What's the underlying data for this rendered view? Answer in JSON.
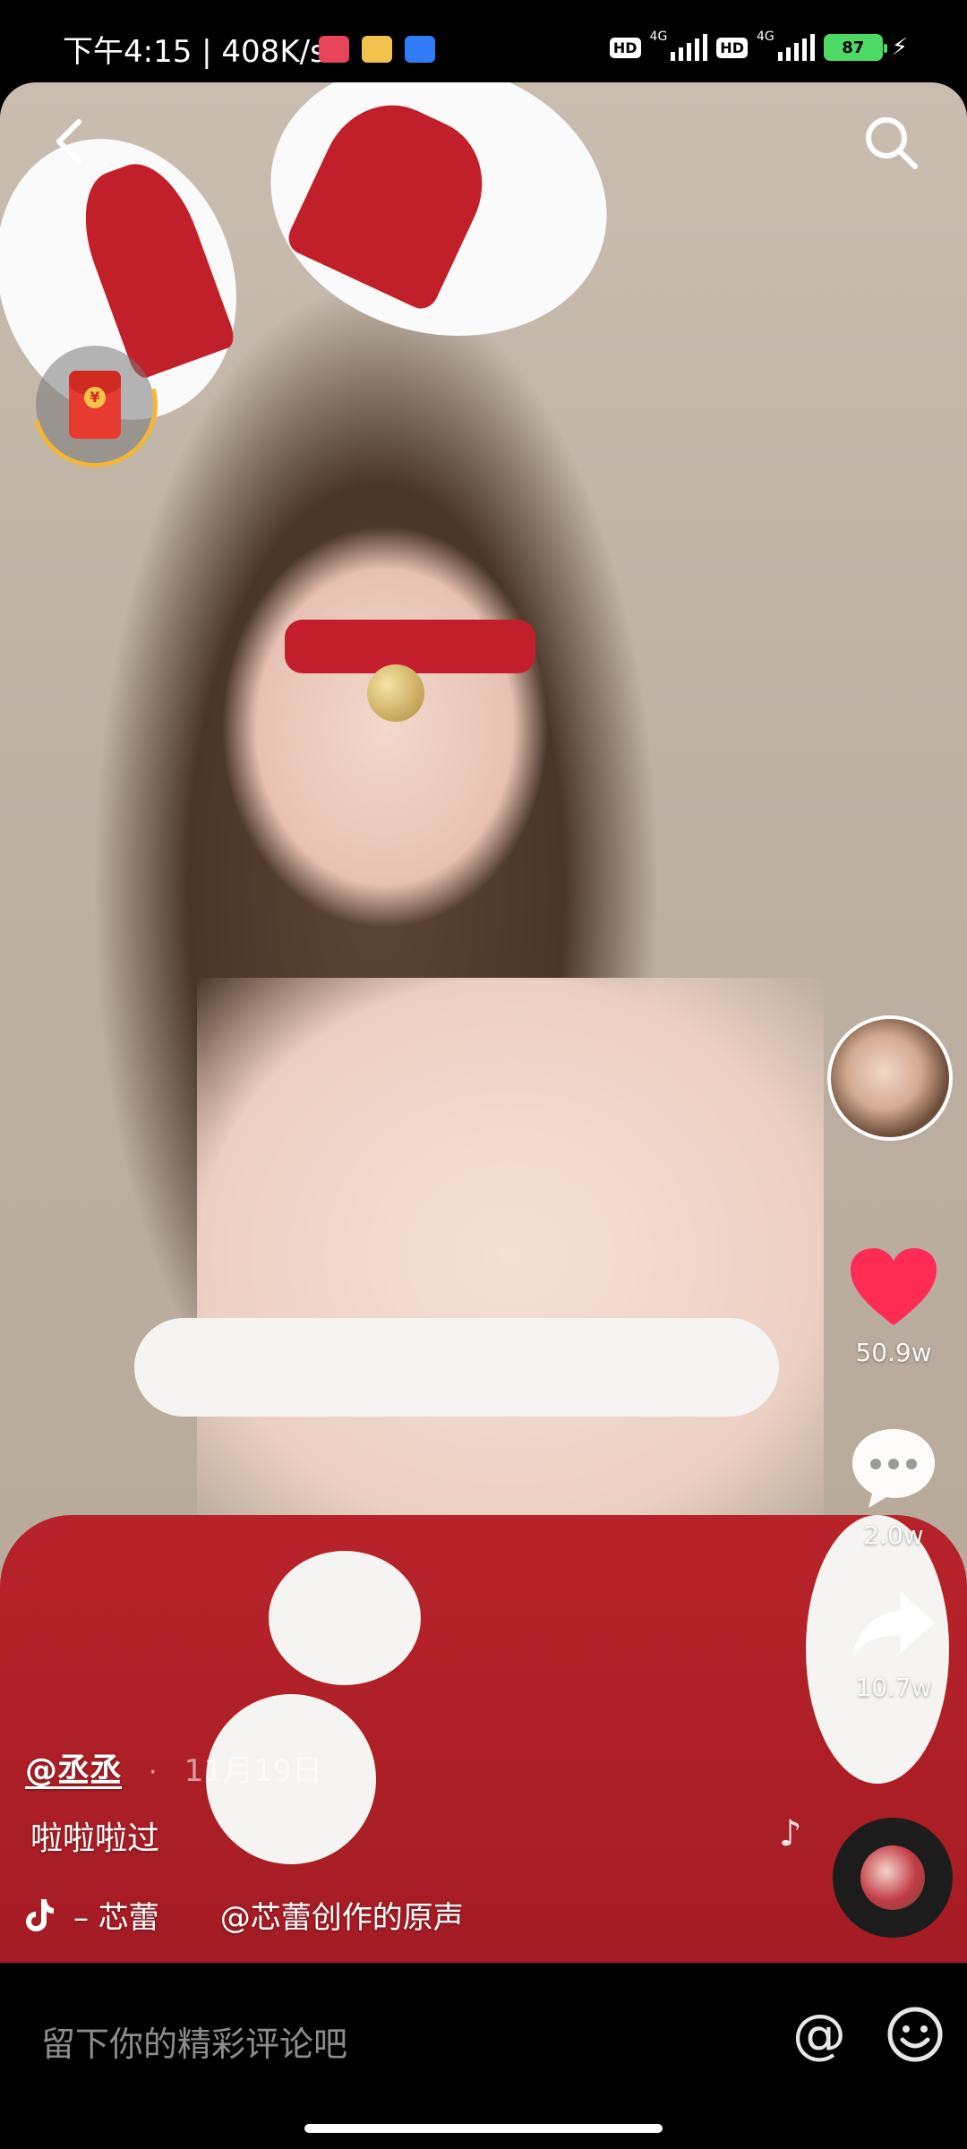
{
  "status_bar": {
    "time": "下午4:15 | 408K/s",
    "network_1": "4G",
    "network_2": "4G",
    "hd_label": "HD",
    "battery": "87"
  },
  "video": {
    "author": "@丞丞",
    "separator": "·",
    "date": "11月19日",
    "description": "啦啦啦过",
    "music": "– 芯蕾　　@芯蕾创作的原声"
  },
  "rail": {
    "likes": "50.9w",
    "comments": "2.0w",
    "shares": "10.7w"
  },
  "comment_bar": {
    "placeholder": "留下你的精彩评论吧",
    "at_symbol": "@"
  },
  "colors": {
    "like": "#fe2c55",
    "battery": "#4cd964",
    "redpacket_ring": "#f4b63a"
  },
  "icons": [
    "back-icon",
    "search-icon",
    "red-packet-icon",
    "heart-icon",
    "comment-icon",
    "share-icon",
    "music-note-icon",
    "tiktok-icon",
    "at-icon",
    "emoji-icon"
  ]
}
